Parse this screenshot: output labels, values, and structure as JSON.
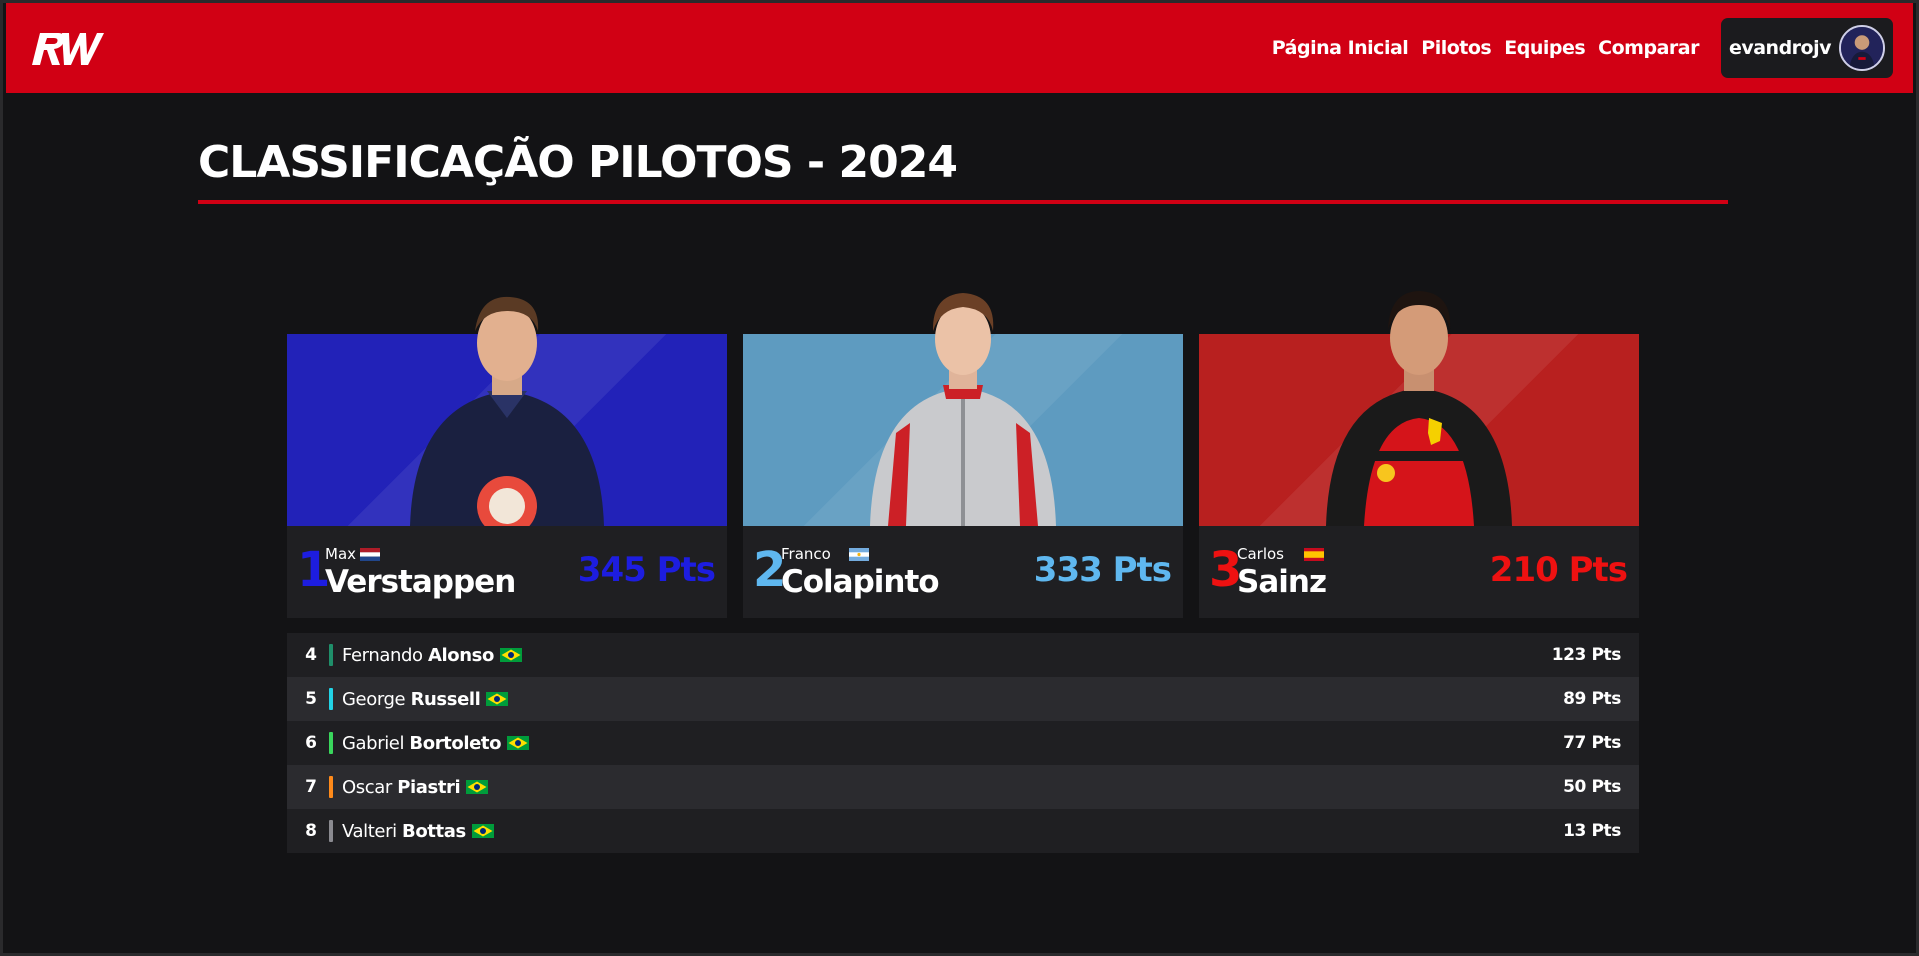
{
  "header": {
    "logo_text": "RW",
    "nav": [
      {
        "label": "Página Inicial"
      },
      {
        "label": "Pilotos"
      },
      {
        "label": "Equipes"
      },
      {
        "label": "Comparar"
      }
    ],
    "user": {
      "name": "evandrojv"
    }
  },
  "page": {
    "title": "CLASSIFICAÇÃO PILOTOS - 2024"
  },
  "podium": [
    {
      "position": "1",
      "first_name": "Max",
      "last_name": "Verstappen",
      "points": "345 Pts",
      "flag": "netherlands-flag",
      "color": "#1d1de0",
      "art_color": "#2222b8"
    },
    {
      "position": "2",
      "first_name": "Franco",
      "last_name": "Colapinto",
      "points": "333 Pts",
      "flag": "argentina-flag",
      "color": "#5fb7ef",
      "art_color": "#5e9bc0"
    },
    {
      "position": "3",
      "first_name": "Carlos",
      "last_name": "Sainz",
      "points": "210 Pts",
      "flag": "spain-flag",
      "color": "#ee1111",
      "art_color": "#b8201f"
    }
  ],
  "standings": [
    {
      "position": "4",
      "first_name": "Fernando",
      "last_name": "Alonso",
      "points": "123 Pts",
      "team_color": "#1f8f6a",
      "flag": "brazil-flag"
    },
    {
      "position": "5",
      "first_name": "George",
      "last_name": "Russell",
      "points": "89 Pts",
      "team_color": "#22d3e6",
      "flag": "brazil-flag"
    },
    {
      "position": "6",
      "first_name": "Gabriel",
      "last_name": "Bortoleto",
      "points": "77 Pts",
      "team_color": "#39d65c",
      "flag": "brazil-flag"
    },
    {
      "position": "7",
      "first_name": "Oscar",
      "last_name": "Piastri",
      "points": "50 Pts",
      "team_color": "#ff8a1a",
      "flag": "brazil-flag"
    },
    {
      "position": "8",
      "first_name": "Valteri",
      "last_name": "Bottas",
      "points": "13 Pts",
      "team_color": "#8a8a90",
      "flag": "brazil-flag"
    }
  ]
}
